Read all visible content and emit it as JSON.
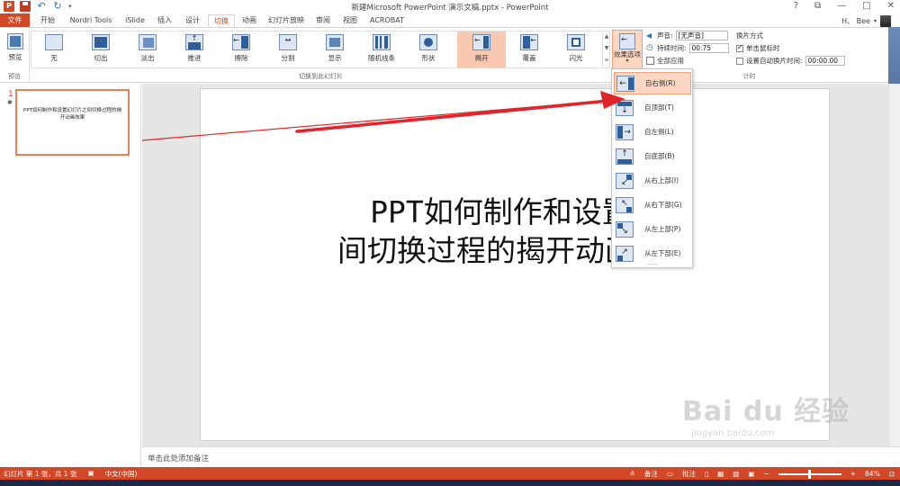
{
  "titlebar": {
    "app_logo": "P",
    "title": "新建Microsoft PowerPoint 演示文稿.pptx - PowerPoint",
    "controls": [
      "?",
      "⧉",
      "—",
      "□",
      "✕"
    ]
  },
  "tabs": [
    "文件",
    "开始",
    "Nordri Tools",
    "iSlide",
    "插入",
    "设计",
    "切换",
    "动画",
    "幻灯片放映",
    "审阅",
    "视图",
    "ACROBAT"
  ],
  "active_tab": "切换",
  "user": {
    "name": "H、 Bee"
  },
  "ribbon": {
    "preview_label": "预览",
    "preview_group": "预览",
    "gallery_group": "切换到此幻灯片",
    "timing_group": "计时",
    "transitions": [
      "无",
      "切出",
      "淡出",
      "推进",
      "擦除",
      "分割",
      "显示",
      "随机线条",
      "形状",
      "揭开",
      "覆盖",
      "闪光"
    ],
    "selected_transition": "揭开",
    "effect_options": "效果选项",
    "sound_label": "声音:",
    "sound_value": "[无声音]",
    "duration_label": "持续时间:",
    "duration_value": "00.75",
    "apply_all": "全部应用",
    "advance_label": "换片方式",
    "on_click": "单击鼠标时",
    "after_label": "设置自动换片时间:",
    "after_value": "00:00.00"
  },
  "thumbnail": {
    "number": "1",
    "star": "✱",
    "text": "PPT如何制作和设置幻灯片之间切换过程的揭开动画效果"
  },
  "slide": {
    "title_line1": "PPT如何制作和设置幻",
    "title_line2": "间切换过程的揭开动画效果"
  },
  "effect_menu": {
    "items": [
      "自右侧(R)",
      "自顶部(T)",
      "自左侧(L)",
      "自底部(B)",
      "从右上部(I)",
      "从右下部(G)",
      "从左上部(P)",
      "从左下部(E)"
    ],
    "more": "....."
  },
  "notes": "单击此处添加备注",
  "status": {
    "slide_info": "幻灯片 第 1 张，共 1 张",
    "language": "中文(中国)",
    "notes_btn": "备注",
    "comments_btn": "批注",
    "zoom": "84%",
    "zoom_fraction": 0.5
  },
  "watermark": {
    "main": "Bai du 经验",
    "sub": "jingyan.baidu.com"
  },
  "colors": {
    "accent": "#d24726",
    "selected": "#fbd6c2",
    "arrow": "#e0252a"
  }
}
